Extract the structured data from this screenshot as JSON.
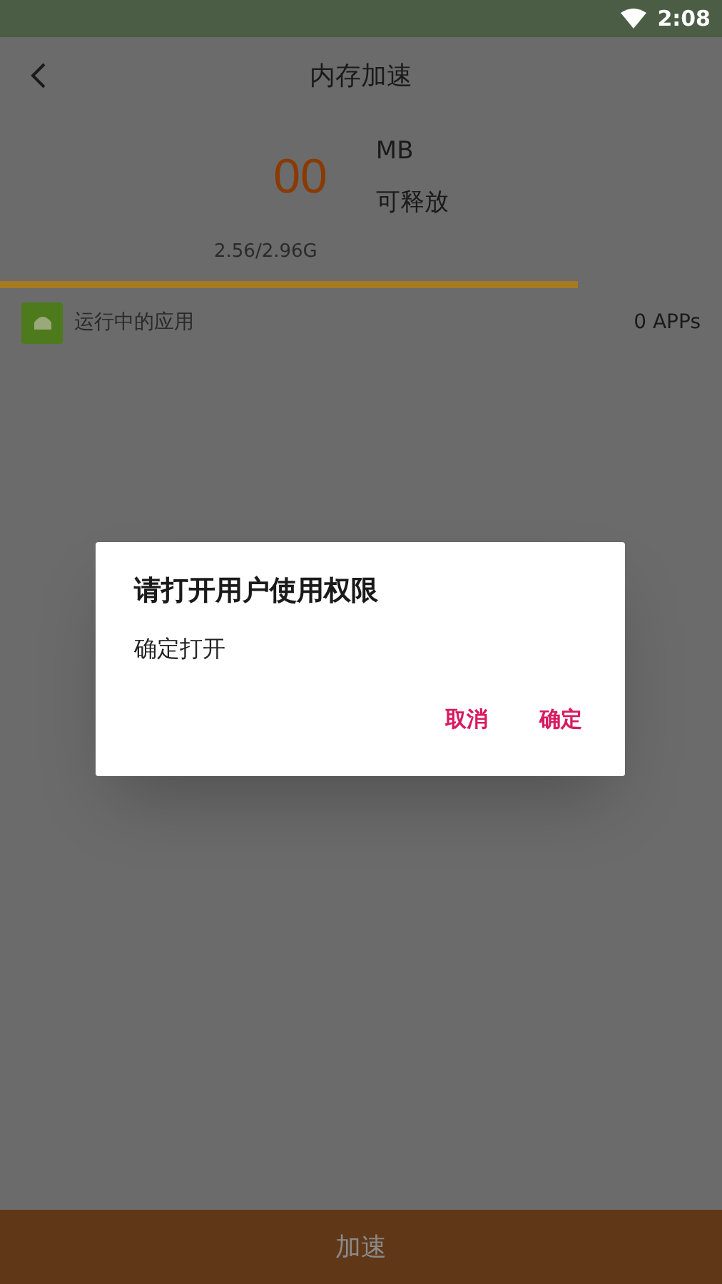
{
  "status_bar": {
    "time": "2:08"
  },
  "header": {
    "title": "内存加速"
  },
  "memory": {
    "amount": "00",
    "unit": "MB",
    "caption": "可释放",
    "usage": "2.56/2.96G",
    "level": 0.8
  },
  "running_apps": {
    "label": "运行中的应用",
    "count": "0 APPs"
  },
  "dialog": {
    "title": "请打开用户使用权限",
    "message": "确定打开",
    "buttons": [
      "取消",
      "确定"
    ]
  },
  "action_button": {
    "label": "加速"
  }
}
